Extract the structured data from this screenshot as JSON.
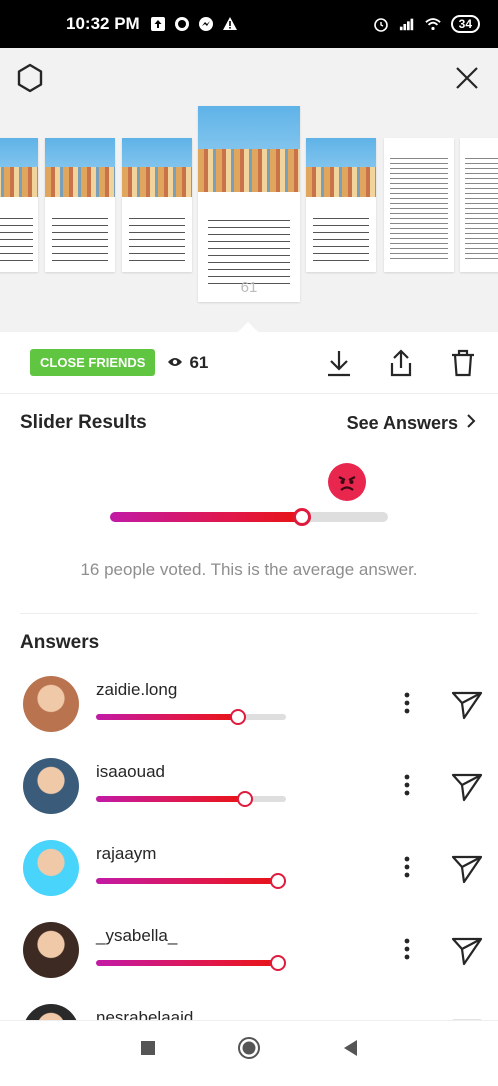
{
  "status_bar": {
    "time": "10:32 PM",
    "battery": "34"
  },
  "story_viewer": {
    "current_viewers": "61",
    "thumbnails": [
      {
        "kind": "photo",
        "count": "62"
      },
      {
        "kind": "photo",
        "count": "62"
      },
      {
        "kind": "photo",
        "count": "61"
      },
      {
        "kind": "photo",
        "count": "61",
        "selected": true
      },
      {
        "kind": "photo",
        "count": "60"
      },
      {
        "kind": "text",
        "count": ""
      },
      {
        "kind": "text",
        "count": ""
      }
    ]
  },
  "action_bar": {
    "badge": "CLOSE FRIENDS",
    "views": "61"
  },
  "slider_results": {
    "title": "Slider Results",
    "see_answers": "See Answers",
    "average": 0.69,
    "votes_text": "16 people voted. This is the average answer.",
    "emoji": "angry-face"
  },
  "answers": {
    "title": "Answers",
    "items": [
      {
        "username": "zaidie.long",
        "value": 0.78,
        "avatar_color": "#b9744f"
      },
      {
        "username": "isaaouad",
        "value": 0.82,
        "avatar_color": "#3a5b7a"
      },
      {
        "username": "rajaaym",
        "value": 1.0,
        "avatar_color": "#48d4fb"
      },
      {
        "username": "_ysabella_",
        "value": 1.0,
        "avatar_color": "#3d2a22"
      },
      {
        "username": "nesrabelaaid",
        "value": 1.0,
        "avatar_color": "#2a2a2a"
      }
    ]
  },
  "colors": {
    "close_friends": "#60c541",
    "slider_start": "#c21aa6",
    "slider_end": "#e81414"
  }
}
